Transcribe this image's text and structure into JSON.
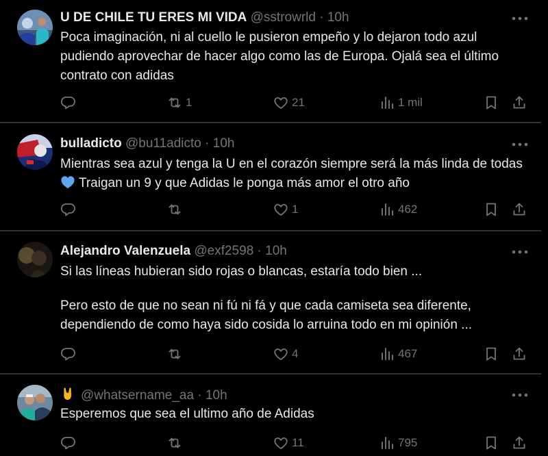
{
  "tweets": [
    {
      "name": "U DE CHILE TU ERES MI VIDA",
      "handle": "@sstrowrld",
      "time": "10h",
      "text": [
        "Poca imaginación, ni al cuello le pusieron empeño y lo dejaron todo azul pudiendo aprovechar de hacer algo como las de Europa. Ojalá sea el último contrato con adidas"
      ],
      "replies": "",
      "retweets": "1",
      "likes": "21",
      "views": "1 mil"
    },
    {
      "name": "bulladicto",
      "handle": "@bu11adicto",
      "time": "10h",
      "text_before_emoji": "Mientras sea azul y tenga la U en el corazón siempre será la más linda de todas",
      "text_after_emoji": "Traigan un 9 y que Adidas le ponga más amor el otro año",
      "emoji": "blue-heart",
      "replies": "",
      "retweets": "",
      "likes": "1",
      "views": "462"
    },
    {
      "name": "Alejandro Valenzuela",
      "handle": "@exf2598",
      "time": "10h",
      "text": [
        "Si las líneas hubieran sido rojas o blancas, estaría todo bien ...",
        "Pero esto de que no sean ni fú ni fá y que  cada camiseta sea diferente, dependiendo de como haya sido cosida lo arruina todo en mi opinión ..."
      ],
      "replies": "",
      "retweets": "",
      "likes": "4",
      "views": "467"
    },
    {
      "name": "",
      "name_emoji": "sign-of-the-horns",
      "handle": "@whatsername_aa",
      "time": "10h",
      "text": [
        "Esperemos que sea el ultimo año de Adidas"
      ],
      "replies": "",
      "retweets": "",
      "likes": "11",
      "views": "795"
    }
  ],
  "separator": "·",
  "colors": {
    "background": "#000000",
    "text": "#e7e9ea",
    "secondary": "#71767b",
    "divider": "#2f3336",
    "heart_emoji": "#5da7f0"
  },
  "icons": {
    "reply": "reply-icon",
    "retweet": "retweet-icon",
    "like": "heart-icon",
    "views": "views-icon",
    "bookmark": "bookmark-icon",
    "share": "share-icon",
    "more": "more-icon"
  }
}
